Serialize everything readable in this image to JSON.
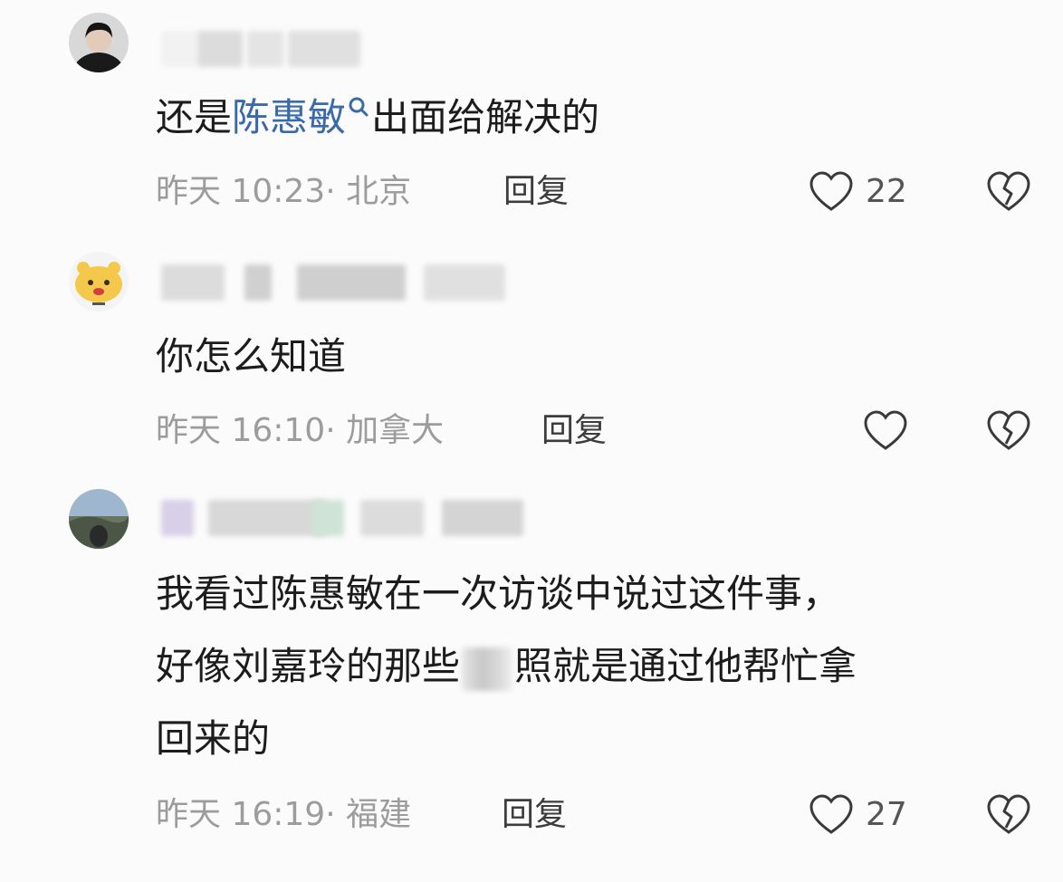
{
  "comments": [
    {
      "text_before": "还是",
      "link_text": "陈惠敏",
      "text_after": "出面给解决的",
      "time": "昨天 10:23",
      "separator": "·",
      "location": "北京",
      "reply_label": "回复",
      "likes": "22"
    },
    {
      "text": "你怎么知道",
      "time": "昨天 16:10",
      "separator": "·",
      "location": "加拿大",
      "reply_label": "回复",
      "likes": ""
    },
    {
      "line1": "我看过陈惠敏在一次访谈中说过这件事，",
      "line2_before": "好像刘嘉玲的那些",
      "line2_after": "照就是通过他帮忙拿",
      "line3": "回来的",
      "time": "昨天 16:19",
      "separator": "·",
      "location": "福建",
      "reply_label": "回复",
      "likes": "27"
    }
  ],
  "icons": {
    "like": "heart-outline-icon",
    "dislike": "broken-heart-icon",
    "search": "search-icon"
  },
  "colors": {
    "link": "#3a6aa8",
    "meta": "#9c9c9c",
    "text": "#1c1c1c"
  }
}
